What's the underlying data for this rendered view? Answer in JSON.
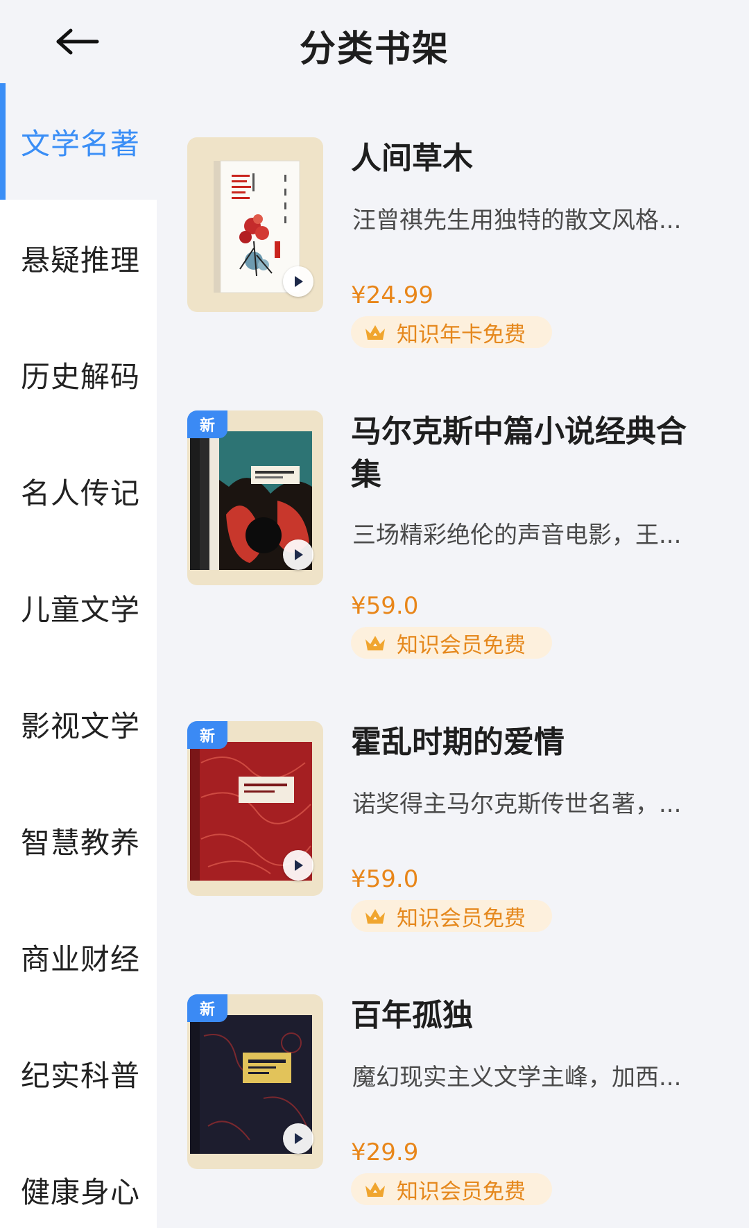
{
  "header": {
    "title": "分类书架"
  },
  "categories": [
    {
      "label": "文学名著",
      "active": true
    },
    {
      "label": "悬疑推理"
    },
    {
      "label": "历史解码"
    },
    {
      "label": "名人传记"
    },
    {
      "label": "儿童文学"
    },
    {
      "label": "影视文学"
    },
    {
      "label": "智慧教养"
    },
    {
      "label": "商业财经"
    },
    {
      "label": "纪实科普"
    },
    {
      "label": "健康身心"
    }
  ],
  "books": [
    {
      "title": "人间草木",
      "description": "汪曾祺先生用独特的散文风格...",
      "price": "¥24.99",
      "tag": "知识年卡免费",
      "is_new": false
    },
    {
      "title": "马尔克斯中篇小说经典合集",
      "description": "三场精彩绝伦的声音电影，王...",
      "price": "¥59.0",
      "tag": "知识会员免费",
      "is_new": true,
      "badge": "新"
    },
    {
      "title": "霍乱时期的爱情",
      "description": "诺奖得主马尔克斯传世名著，...",
      "price": "¥59.0",
      "tag": "知识会员免费",
      "is_new": true,
      "badge": "新"
    },
    {
      "title": "百年孤独",
      "description": "魔幻现实主义文学主峰，加西...",
      "price": "¥29.9",
      "tag": "知识会员免费",
      "is_new": true,
      "badge": "新"
    }
  ],
  "icons": {
    "back": "arrow-left-icon",
    "play": "play-icon",
    "crown": "crown-icon"
  },
  "colors": {
    "accent": "#3a8ef6",
    "price": "#e8861a",
    "tag_bg": "#fdf0dd"
  }
}
